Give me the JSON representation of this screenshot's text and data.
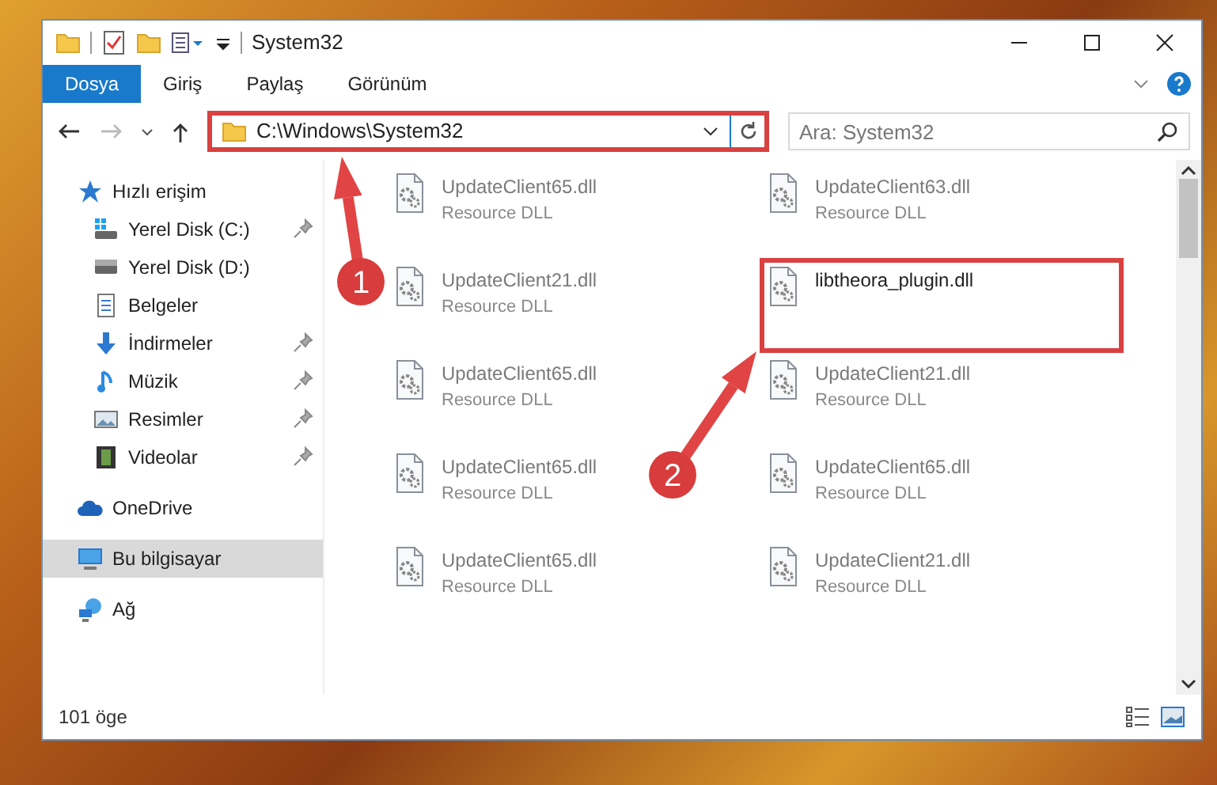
{
  "window": {
    "title": "System32"
  },
  "ribbon_tabs": [
    {
      "label": "Dosya",
      "kind": "file"
    },
    {
      "label": "Giriş",
      "kind": "tab"
    },
    {
      "label": "Paylaş",
      "kind": "tab"
    },
    {
      "label": "Görünüm",
      "kind": "tab"
    }
  ],
  "address_bar": {
    "path": "C:\\Windows\\System32",
    "highlighted": true
  },
  "search": {
    "placeholder": "Ara: System32"
  },
  "sidebar": {
    "items": [
      {
        "label": "Hızlı erişim",
        "kind": "star",
        "pinned": false,
        "selected": false,
        "children": [
          {
            "label": "Yerel Disk (C:)",
            "kind": "windrive",
            "pinned": true,
            "selected": false
          },
          {
            "label": "Yerel Disk (D:)",
            "kind": "drive",
            "pinned": false,
            "selected": false
          },
          {
            "label": "Belgeler",
            "kind": "docs",
            "pinned": false,
            "selected": false
          },
          {
            "label": "İndirmeler",
            "kind": "download",
            "pinned": true,
            "selected": false
          },
          {
            "label": "Müzik",
            "kind": "music",
            "pinned": true,
            "selected": false
          },
          {
            "label": "Resimler",
            "kind": "pictures",
            "pinned": true,
            "selected": false
          },
          {
            "label": "Videolar",
            "kind": "video",
            "pinned": true,
            "selected": false
          }
        ]
      },
      {
        "label": "OneDrive",
        "kind": "cloud",
        "pinned": false,
        "selected": false
      },
      {
        "label": "Bu bilgisayar",
        "kind": "computer",
        "pinned": false,
        "selected": true
      },
      {
        "label": "Ağ",
        "kind": "network",
        "pinned": false,
        "selected": false
      }
    ]
  },
  "files": [
    {
      "name": "UpdateClient65.dll",
      "type": "Resource DLL",
      "dimmed": true,
      "highlighted": false
    },
    {
      "name": "UpdateClient63.dll",
      "type": "Resource DLL",
      "dimmed": true,
      "highlighted": false
    },
    {
      "name": "UpdateClient21.dll",
      "type": "Resource DLL",
      "dimmed": true,
      "highlighted": false
    },
    {
      "name": "libtheora_plugin.dll",
      "dimmed": false,
      "highlighted": true
    },
    {
      "name": "UpdateClient65.dll",
      "type": "Resource DLL",
      "dimmed": true,
      "highlighted": false
    },
    {
      "name": "UpdateClient21.dll",
      "type": "Resource DLL",
      "dimmed": true,
      "highlighted": false
    },
    {
      "name": "UpdateClient65.dll",
      "type": "Resource DLL",
      "dimmed": true,
      "highlighted": false
    },
    {
      "name": "UpdateClient65.dll",
      "type": "Resource DLL",
      "dimmed": true,
      "highlighted": false
    },
    {
      "name": "UpdateClient65.dll",
      "type": "Resource DLL",
      "dimmed": true,
      "highlighted": false
    },
    {
      "name": "UpdateClient21.dll",
      "type": "Resource DLL",
      "dimmed": true,
      "highlighted": false
    }
  ],
  "status_bar": {
    "count": "101 öge"
  },
  "callouts": [
    {
      "number": "1"
    },
    {
      "number": "2"
    }
  ]
}
